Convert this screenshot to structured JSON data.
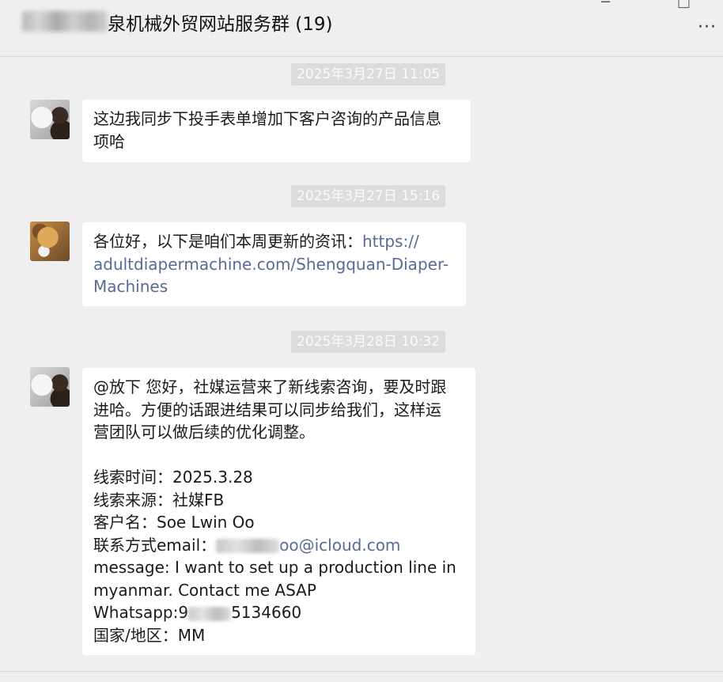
{
  "header": {
    "title": "泉机械外贸网站服务群 (19)",
    "window_controls": [
      "−",
      "□"
    ],
    "more_icon": "more-dots-icon",
    "more_label": "···"
  },
  "messages": [
    {
      "timestamp": "2025年3月27日 11:05",
      "avatar": "cat-avatar",
      "lines": [
        "这边我同步下投手表单增加下客户咨询的产品信息",
        "项哈"
      ]
    },
    {
      "timestamp": "2025年3月27日 15:16",
      "avatar": "dog-avatar",
      "line1_prefix": "各位好，以下是咱们本周更新的资讯：",
      "line1_link": "https://",
      "link_line2": "adultdiapermachine.com/Shengquan-Diaper-",
      "link_line3": "Machines"
    },
    {
      "timestamp": "2025年3月28日 10:32",
      "avatar": "cat-avatar",
      "intro": [
        "@放下 您好，社媒运营来了新线索咨询，要及时跟",
        "进哈。方便的话跟进结果可以同步给我们，这样运",
        "营团队可以做后续的优化调整。"
      ],
      "lead_time": "线索时间：2025.3.28",
      "lead_source": "线索来源：社媒FB",
      "customer_name": "客户名：Soe Lwin Oo",
      "email_label": "联系方式email：",
      "email_visible": "oo@icloud.com",
      "message_lines": [
        "message: I want to set up a production line in",
        "myanmar. Contact me ASAP"
      ],
      "whatsapp_label": "Whatsapp:9",
      "whatsapp_visible": "5134660",
      "region": "国家/地区：MM"
    }
  ]
}
